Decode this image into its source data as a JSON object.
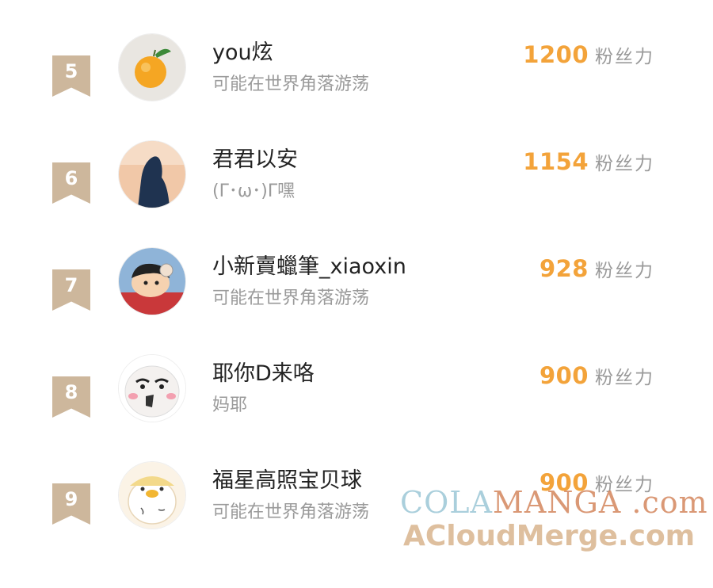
{
  "ranking": [
    {
      "rank": "5",
      "username": "you炫",
      "bio": "可能在世界角落游荡",
      "fans": "1200",
      "fans_unit": "粉丝力",
      "avatar": "orange-fruit-avatar"
    },
    {
      "rank": "6",
      "username": "君君以安",
      "bio": "(Γ･ω･)Γ嘿",
      "fans": "1154",
      "fans_unit": "粉丝力",
      "avatar": "silhouette-avatar"
    },
    {
      "rank": "7",
      "username": "小新賣蠟筆_xiaoxin",
      "bio": "可能在世界角落游荡",
      "fans": "928",
      "fans_unit": "粉丝力",
      "avatar": "cartoon-boy-avatar"
    },
    {
      "rank": "8",
      "username": "耶你D来咯",
      "bio": "妈耶",
      "fans": "900",
      "fans_unit": "粉丝力",
      "avatar": "meme-face-avatar"
    },
    {
      "rank": "9",
      "username": "福星高照宝贝球",
      "bio": "可能在世界角落游荡",
      "fans": "900",
      "fans_unit": "粉丝力",
      "avatar": "duck-avatar"
    }
  ],
  "watermark": {
    "line1_a": "COLA",
    "line1_b": "MANGA",
    "line1_c": " .com",
    "line2": "ACloudMerge.com"
  },
  "colors": {
    "badge": "#cdb79c",
    "fans_value": "#f3a33a",
    "username": "#222222",
    "secondary_text": "#9a9a9a"
  }
}
